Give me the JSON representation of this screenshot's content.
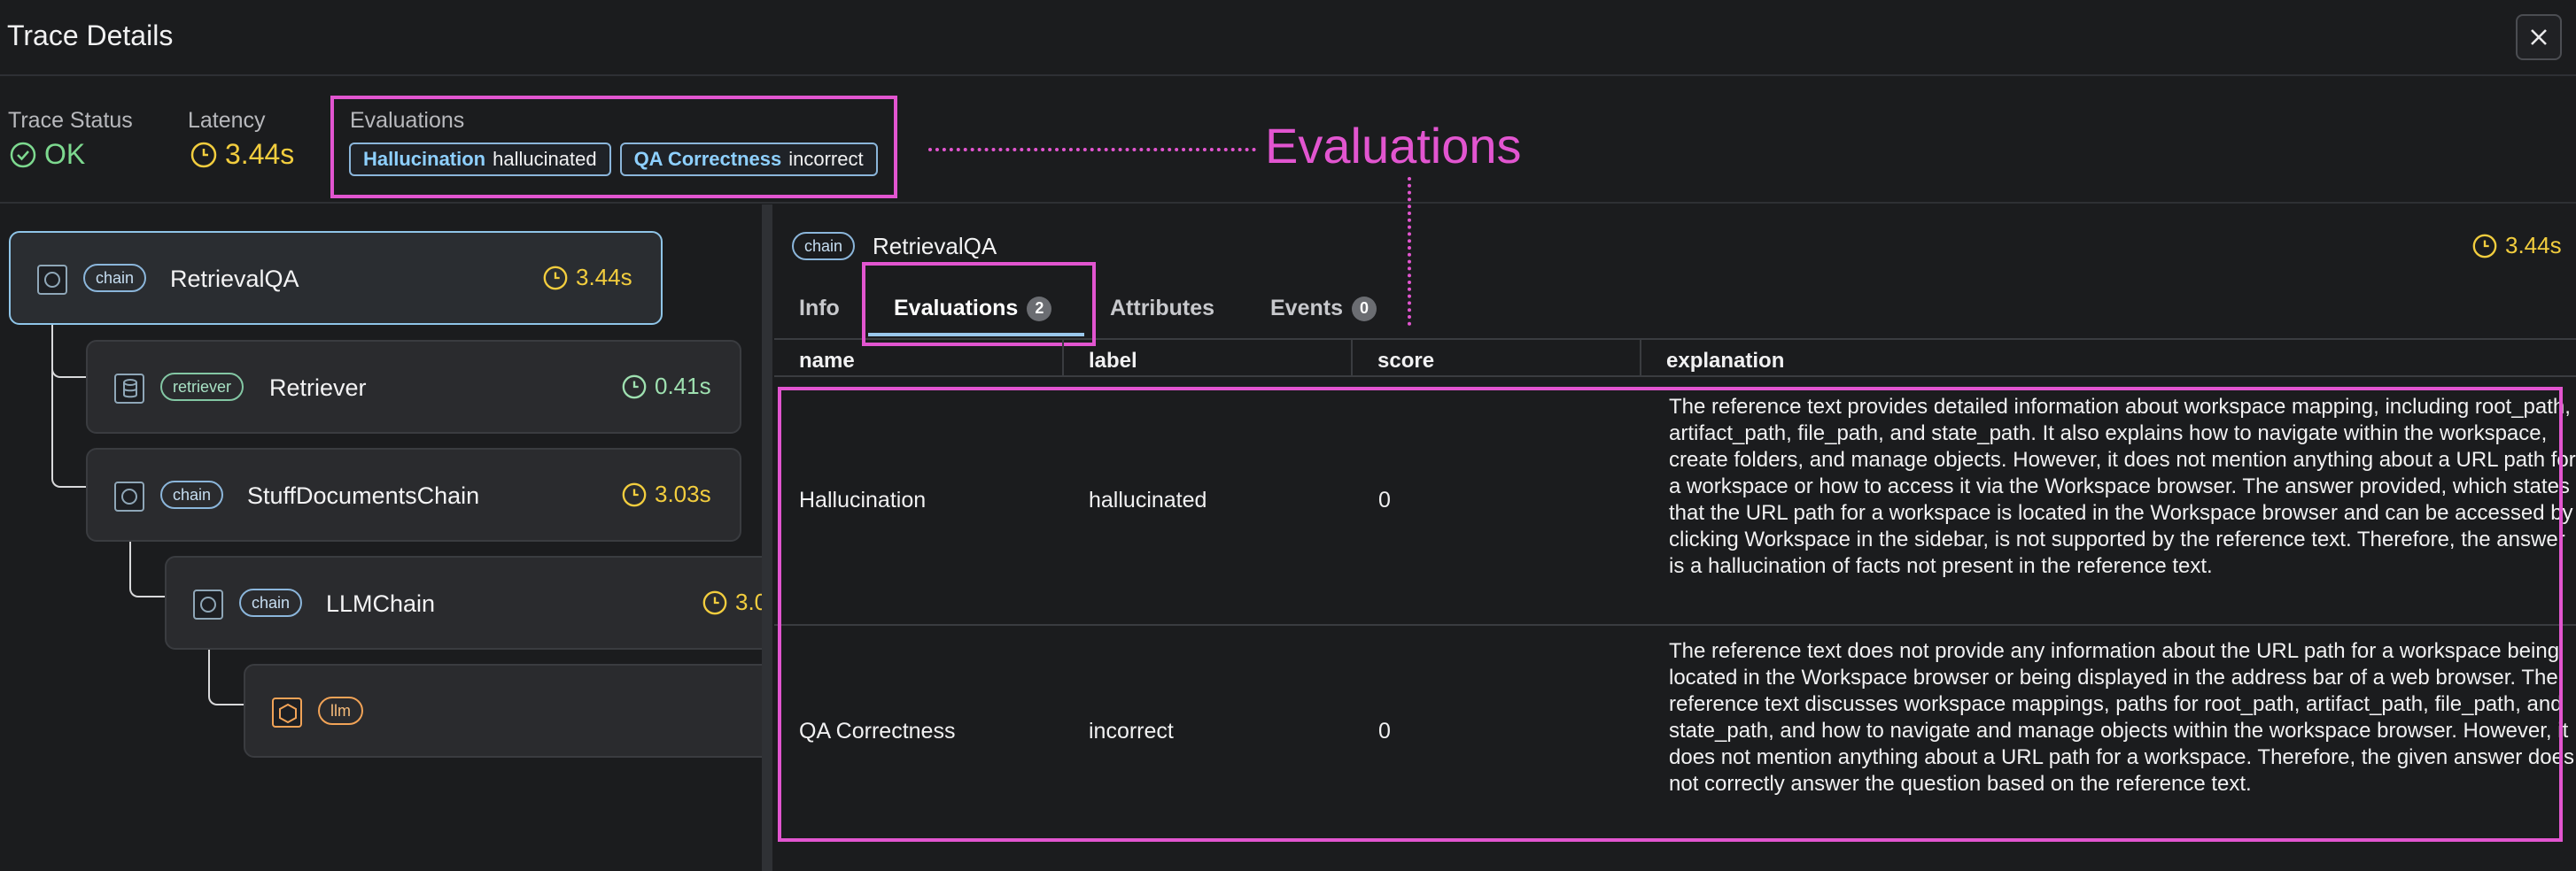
{
  "header": {
    "title": "Trace Details"
  },
  "summary": {
    "trace_status_label": "Trace Status",
    "trace_status_value": "OK",
    "latency_label": "Latency",
    "latency_value": "3.44s",
    "evaluations_label": "Evaluations",
    "evaluation_pills": [
      {
        "name": "Hallucination",
        "label": "hallucinated"
      },
      {
        "name": "QA Correctness",
        "label": "incorrect"
      }
    ]
  },
  "annotation": {
    "text": "Evaluations"
  },
  "tree": {
    "nodes": [
      {
        "kind": "chain",
        "name": "RetrievalQA",
        "latency": "3.44s"
      },
      {
        "kind": "retriever",
        "name": "Retriever",
        "latency": "0.41s"
      },
      {
        "kind": "chain",
        "name": "StuffDocumentsChain",
        "latency": "3.03s"
      },
      {
        "kind": "chain",
        "name": "LLMChain",
        "latency": "3.0"
      },
      {
        "kind": "llm",
        "name": "",
        "latency": ""
      }
    ]
  },
  "span": {
    "kind": "chain",
    "name": "RetrievalQA",
    "latency": "3.44s"
  },
  "tabs": [
    {
      "label": "Info",
      "count": ""
    },
    {
      "label": "Evaluations",
      "count": "2"
    },
    {
      "label": "Attributes",
      "count": ""
    },
    {
      "label": "Events",
      "count": "0"
    }
  ],
  "table": {
    "columns": [
      "name",
      "label",
      "score",
      "explanation"
    ],
    "rows": [
      {
        "name": "Hallucination",
        "label": "hallucinated",
        "score": "0",
        "explanation": "The reference text provides detailed information about workspace mapping, including root_path, artifact_path, file_path, and state_path. It also explains how to navigate within the workspace, create folders, and manage objects. However, it does not mention anything about a URL path for a workspace or how to access it via the Workspace browser. The answer provided, which states that the URL path for a workspace is located in the Workspace browser and can be accessed by clicking Workspace in the sidebar, is not supported by the reference text. Therefore, the answer is a hallucination of facts not present in the reference text."
      },
      {
        "name": "QA Correctness",
        "label": "incorrect",
        "score": "0",
        "explanation": "The reference text does not provide any information about the URL path for a workspace being located in the Workspace browser or being displayed in the address bar of a web browser. The reference text discusses workspace mappings, paths for root_path, artifact_path, file_path, and state_path, and how to navigate and manage objects within the workspace browser. However, it does not mention anything about a URL path for a workspace. Therefore, the given answer does not correctly answer the question based on the reference text."
      }
    ]
  },
  "colors": {
    "accent": "#e255d0",
    "ok": "#7dd98f",
    "latency": "#f2cd3e",
    "selected": "#8fc5e8"
  }
}
